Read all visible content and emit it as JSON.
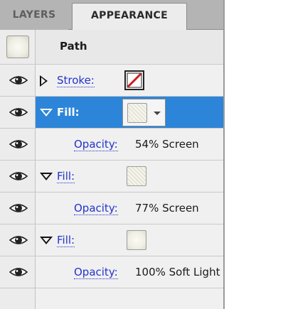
{
  "tabs": [
    {
      "label": "LAYERS"
    },
    {
      "label": "APPEARANCE"
    }
  ],
  "header": {
    "title": "Path"
  },
  "rows": {
    "stroke": {
      "label": "Stroke:",
      "swatch": "none"
    },
    "fill1": {
      "label": "Fill:",
      "opacity_label": "Opacity:",
      "opacity_value": "54% Screen"
    },
    "fill2": {
      "label": "Fill:",
      "opacity_label": "Opacity:",
      "opacity_value": "77% Screen"
    },
    "fill3": {
      "label": "Fill:",
      "opacity_label": "Opacity:",
      "opacity_value": "100% Soft Light"
    }
  },
  "colors": {
    "selection": "#2c85d8",
    "link": "#2233cc",
    "tab_bar": "#b4b4b4"
  },
  "icons": [
    "eye-icon",
    "disclosure-triangle-icon",
    "dropdown-arrow-icon",
    "none-swatch-icon"
  ]
}
